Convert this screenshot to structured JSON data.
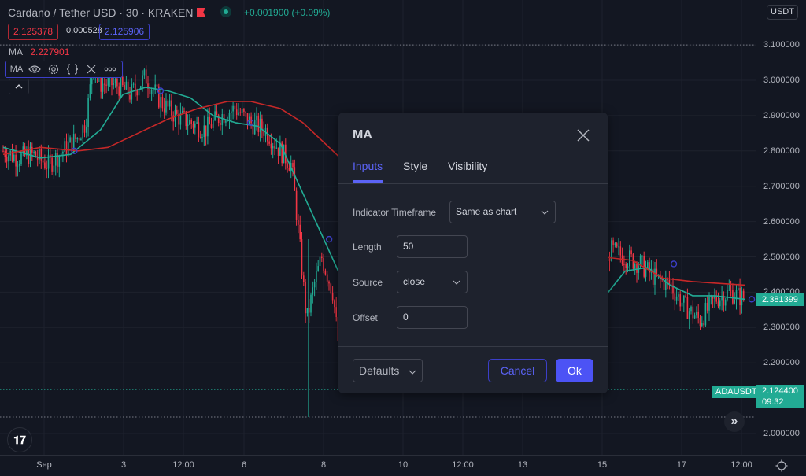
{
  "header": {
    "symbol_title": "Cardano / Tether USD · 30 · KRAKEN",
    "change": "+0.001900 (+0.09%)",
    "bid": "2.125378",
    "spread": "0.000528",
    "ask": "2.125906"
  },
  "indicator_legend": {
    "label": "MA",
    "value": "2.227901",
    "toolbar_label": "MA",
    "toolbar_icons": [
      "eye-icon",
      "gear-icon",
      "braces-icon",
      "close-icon",
      "more-icon"
    ]
  },
  "price_axis": {
    "currency_badge": "USDT",
    "ticks": [
      "3.100000",
      "3.000000",
      "2.900000",
      "2.800000",
      "2.700000",
      "2.600000",
      "2.500000",
      "2.400000",
      "2.300000",
      "2.200000",
      "2.000000"
    ],
    "last_price_label": "2.381399",
    "symbol_label": "ADAUSDT",
    "symbol_price": "2.124400",
    "countdown": "09:32"
  },
  "time_axis": {
    "ticks": [
      "Sep",
      "3",
      "12:00",
      "6",
      "8",
      "10",
      "12:00",
      "13",
      "15",
      "17",
      "12:00"
    ]
  },
  "colors": {
    "up": "#22ab94",
    "down": "#f23645",
    "ma_fast": "#22ab94",
    "ma_slow": "#c62828",
    "accent": "#5b63f6",
    "background": "#131722"
  },
  "chart_data": {
    "type": "candlestick",
    "title": "Cardano / Tether USD · 30 · KRAKEN",
    "ylim": [
      1.98,
      3.14
    ],
    "y_ticks": [
      2.0,
      2.2,
      2.3,
      2.4,
      2.5,
      2.6,
      2.7,
      2.8,
      2.9,
      3.0,
      3.1
    ],
    "x_ticks": [
      "Sep",
      "3",
      "12:00",
      "6",
      "8",
      "10",
      "12:00",
      "13",
      "15",
      "17",
      "12:00"
    ],
    "close_path": [
      [
        0,
        2.8
      ],
      [
        0.02,
        2.78
      ],
      [
        0.04,
        2.79
      ],
      [
        0.06,
        2.76
      ],
      [
        0.08,
        2.8
      ],
      [
        0.1,
        2.84
      ],
      [
        0.11,
        2.88
      ],
      [
        0.12,
        3.04
      ],
      [
        0.13,
        2.99
      ],
      [
        0.15,
        2.99
      ],
      [
        0.17,
        2.96
      ],
      [
        0.19,
        3.01
      ],
      [
        0.21,
        2.94
      ],
      [
        0.23,
        2.9
      ],
      [
        0.25,
        2.88
      ],
      [
        0.27,
        2.86
      ],
      [
        0.29,
        2.9
      ],
      [
        0.31,
        2.92
      ],
      [
        0.33,
        2.88
      ],
      [
        0.35,
        2.86
      ],
      [
        0.37,
        2.8
      ],
      [
        0.385,
        2.76
      ],
      [
        0.395,
        2.55
      ],
      [
        0.405,
        2.32
      ],
      [
        0.415,
        2.42
      ],
      [
        0.425,
        2.5
      ],
      [
        0.44,
        2.4
      ],
      [
        0.45,
        2.2
      ],
      [
        0.46,
        2.28
      ],
      [
        0.8,
        2.4
      ],
      [
        0.81,
        2.52
      ],
      [
        0.83,
        2.5
      ],
      [
        0.85,
        2.48
      ],
      [
        0.87,
        2.44
      ],
      [
        0.89,
        2.42
      ],
      [
        0.91,
        2.36
      ],
      [
        0.93,
        2.32
      ],
      [
        0.95,
        2.38
      ],
      [
        0.97,
        2.4
      ],
      [
        0.99,
        2.38
      ]
    ],
    "series": [
      {
        "name": "MA (fast)",
        "color": "#22ab94",
        "values": [
          [
            0,
            2.81
          ],
          [
            0.05,
            2.78
          ],
          [
            0.09,
            2.79
          ],
          [
            0.13,
            2.86
          ],
          [
            0.16,
            2.96
          ],
          [
            0.19,
            2.98
          ],
          [
            0.22,
            2.97
          ],
          [
            0.25,
            2.95
          ],
          [
            0.28,
            2.9
          ],
          [
            0.31,
            2.88
          ],
          [
            0.34,
            2.87
          ],
          [
            0.37,
            2.82
          ],
          [
            0.4,
            2.68
          ],
          [
            0.43,
            2.54
          ],
          [
            0.46,
            2.4
          ],
          [
            0.8,
            2.38
          ],
          [
            0.83,
            2.46
          ],
          [
            0.86,
            2.47
          ],
          [
            0.89,
            2.42
          ],
          [
            0.92,
            2.39
          ],
          [
            0.95,
            2.39
          ],
          [
            0.99,
            2.38
          ]
        ]
      },
      {
        "name": "MA (slow)",
        "color": "#c62828",
        "values": [
          [
            0,
            2.79
          ],
          [
            0.05,
            2.81
          ],
          [
            0.1,
            2.8
          ],
          [
            0.14,
            2.81
          ],
          [
            0.18,
            2.85
          ],
          [
            0.22,
            2.89
          ],
          [
            0.26,
            2.92
          ],
          [
            0.3,
            2.94
          ],
          [
            0.33,
            2.94
          ],
          [
            0.37,
            2.92
          ],
          [
            0.4,
            2.88
          ],
          [
            0.43,
            2.82
          ],
          [
            0.46,
            2.76
          ],
          [
            0.8,
            2.5
          ],
          [
            0.84,
            2.49
          ],
          [
            0.88,
            2.44
          ],
          [
            0.92,
            2.43
          ],
          [
            0.99,
            2.42
          ]
        ]
      }
    ],
    "horizontal_lines": [
      {
        "label": "ADAUSDT",
        "value": 2.1244,
        "style": "dotted",
        "color": "#22ab94"
      },
      {
        "value": 2.05,
        "style": "dotted",
        "color": "#787b86"
      },
      {
        "value": 3.1,
        "style": "dotted",
        "color": "#787b86"
      }
    ]
  },
  "dialog": {
    "title": "MA",
    "tabs": [
      "Inputs",
      "Style",
      "Visibility"
    ],
    "active_tab": "Inputs",
    "fields": {
      "timeframe_label": "Indicator Timeframe",
      "timeframe_value": "Same as chart",
      "length_label": "Length",
      "length_value": "50",
      "source_label": "Source",
      "source_value": "close",
      "offset_label": "Offset",
      "offset_value": "0"
    },
    "defaults_label": "Defaults",
    "cancel_label": "Cancel",
    "ok_label": "Ok"
  }
}
